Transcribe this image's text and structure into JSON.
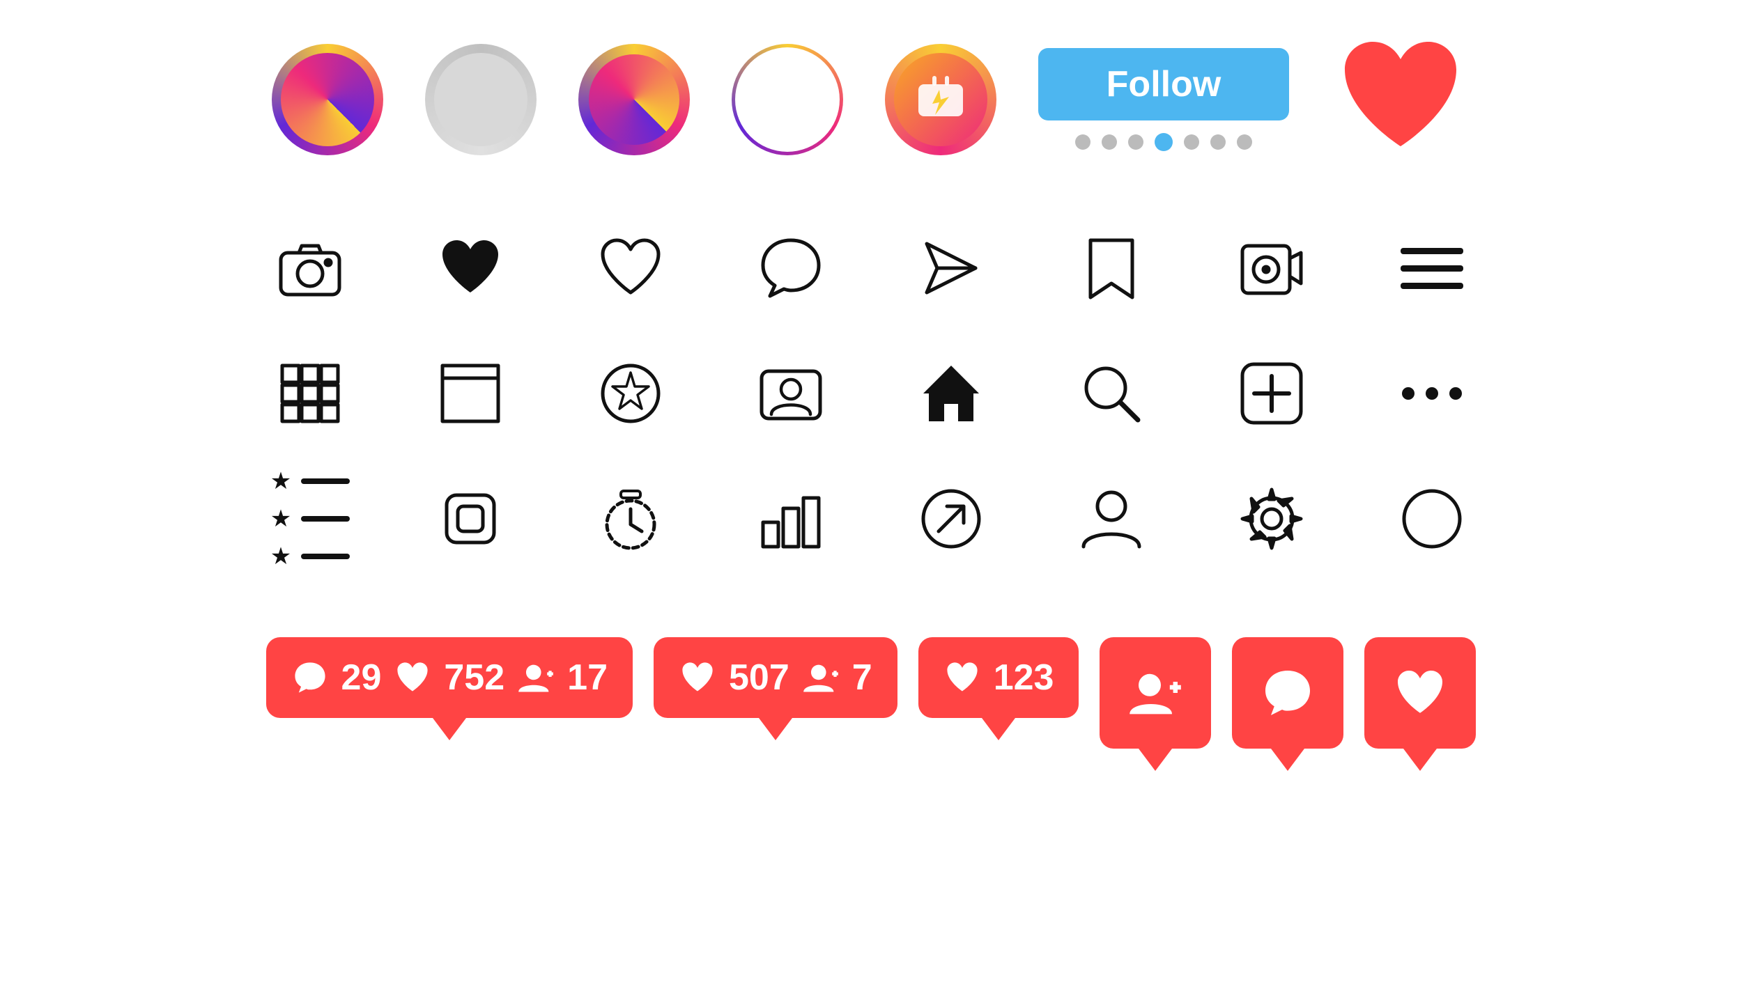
{
  "header": {
    "follow_label": "Follow",
    "dots": [
      "inactive",
      "inactive",
      "inactive",
      "active",
      "inactive",
      "inactive",
      "inactive"
    ]
  },
  "icons": {
    "row1": [
      "camera",
      "heart-filled",
      "heart-outline",
      "comment",
      "send",
      "bookmark",
      "reel",
      "hamburger"
    ],
    "row2": [
      "grid",
      "square",
      "star-circle",
      "person-tag",
      "home",
      "search",
      "plus-square",
      "more"
    ],
    "row3": [
      "star-list",
      "screenshot",
      "clock",
      "bar-chart",
      "link-out",
      "person",
      "gear",
      "circle"
    ]
  },
  "notifications": [
    {
      "comment_count": "29",
      "like_count": "752",
      "follower_count": "17"
    },
    {
      "like_count": "507",
      "follower_count": "7"
    },
    {
      "like_count": "123"
    },
    {
      "type": "follower"
    },
    {
      "type": "comment"
    },
    {
      "type": "like"
    }
  ]
}
